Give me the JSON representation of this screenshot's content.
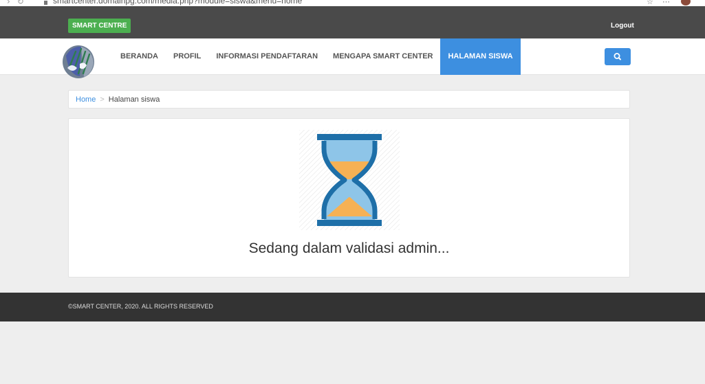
{
  "browser": {
    "url": "smartcenter.domainpg.com/media.php?module=siswa&menu=home"
  },
  "topbar": {
    "brand_label": "SMART CENTRE",
    "logout_label": "Logout"
  },
  "nav": {
    "items": [
      {
        "label": "BERANDA"
      },
      {
        "label": "PROFIL"
      },
      {
        "label": "INFORMASI PENDAFTARAN"
      },
      {
        "label": "MENGAPA SMART CENTER"
      },
      {
        "label": "HALAMAN SISWA"
      }
    ],
    "active_index": 4,
    "search_icon": "search-icon"
  },
  "breadcrumb": {
    "home": "Home",
    "separator": ">",
    "current": "Halaman siswa"
  },
  "main": {
    "status": "Sedang dalam validasi admin...",
    "icon": "hourglass-icon"
  },
  "footer": {
    "copyright": "©SMART CENTER, 2020. ALL RIGHTS RESERVED"
  },
  "colors": {
    "accent": "#3d8fe0",
    "brand_green": "#4caf50",
    "topbar": "#4a4a4a",
    "footer": "#333333",
    "hourglass_frame": "#1e6fa8",
    "hourglass_glass": "#8ec5e8",
    "hourglass_sand": "#f6b154"
  }
}
